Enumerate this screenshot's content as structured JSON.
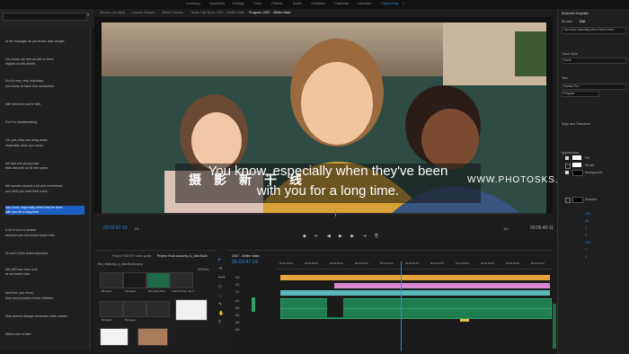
{
  "workspaces": [
    "Learning",
    "Assembly",
    "Editing",
    "Color",
    "Effects",
    "Audio",
    "Graphics",
    "Captions",
    "Libraries",
    "Captioning"
  ],
  "active_workspace": "Captioning",
  "monitor_tabs": [
    "Source: (no clips)",
    "Lumetri Scopes",
    "Effect Controls",
    "Audio Clip Mixer: 2007 - Whiter Mark",
    "Program: 2007 - Whiter Mark"
  ],
  "active_monitor_tab": "Program: 2007 - Whiter Mark",
  "transcript": {
    "lines": [
      "of the manager as you know, take respite.",
      "You know, we see we talk to them",
      "regular on the phone.",
      "So it's very, very important,",
      "you know, to have that connection",
      "with whoever you're with.",
      "For it is heartbreaking.",
      "Oh, yes, they can bring down,",
      "especially when you know,",
      "we had one young man",
      "that was with us for five years.",
      "We wonder around a lot and sometimes",
      "you think you hear their voice.",
      "You know, especially when they've been",
      "with you for a long time.",
      "A lot of love is shared",
      "between you and those foster kids.",
      "So and I think that's important.",
      "We still hear from a lot",
      "of our foster kids.",
      "And then you know,",
      "they send photos of their children.",
      "Kids doesn't always remember their names.",
      "Which one is this?"
    ],
    "selected_index_1": 13,
    "selected_index_2": 14
  },
  "caption": {
    "line1": "You know, especially when they've been",
    "line2": "with you for a long time."
  },
  "watermark": {
    "cn": "摄影新干线",
    "en": "WWW.PHOTOSKS.VIP"
  },
  "monitor": {
    "timecode_left": "00:02:47:19",
    "fit": "Fit",
    "zoom": "1/2",
    "timecode_right": "00:05:40:11"
  },
  "project": {
    "tabs": [
      "Project: BIGGSY radio panel",
      "Project: Rock Anatomy, A_Jobs Build"
    ],
    "active_tab": "Project: Rock Anatomy, A_Jobs Build",
    "path": "Roc_Anatomy_A_Jobs Build.prproj",
    "count": "18 Items",
    "items": [
      "Bin/ages",
      "Clip/ages",
      "Sky/Clips Bins",
      "Sky/Clips Bins",
      "Antoni Photo Jay 2",
      "Bin/ages",
      "Bin/ages",
      "Bin/ages",
      "Bin/ages",
      "Bin/ages"
    ]
  },
  "timeline": {
    "title": "2007 - Whiter Mark",
    "timecode": "00:02:47:19",
    "tracks": [
      "V3",
      "V2",
      "V1",
      "A1",
      "A2",
      "A3",
      "A4",
      "A5"
    ],
    "ruler": [
      "00:02:15:00",
      "00:02:30:00",
      "00:02:45:00",
      "00:03:00:00",
      "00:03:15:00",
      "00:03:30:00",
      "00:03:45:00",
      "00:04:00:00",
      "00:04:15:00",
      "00:04:30:00",
      "00:04:45:00"
    ]
  },
  "essential_graphics": {
    "title": "Essential Graphics",
    "tabs": [
      "Browse",
      "Edit"
    ],
    "active_tab": "Edit",
    "layer": "You know, especially when they've been",
    "sections": [
      "Track Style",
      "Text",
      "Appearance"
    ],
    "track_style": "None",
    "font": "Myriad Pro",
    "font_style": "Regular",
    "align_label": "Align and Transform",
    "appearance_items": [
      "Fill",
      "Stroke",
      "Background",
      "Shadow"
    ],
    "values": [
      "100",
      "40",
      "0",
      "0",
      "100",
      "7",
      "0"
    ],
    "colors": {
      "fill": "#ffffff",
      "background": "#000000",
      "accent": "#2d8ceb",
      "selection": "#1f5ec2"
    }
  }
}
